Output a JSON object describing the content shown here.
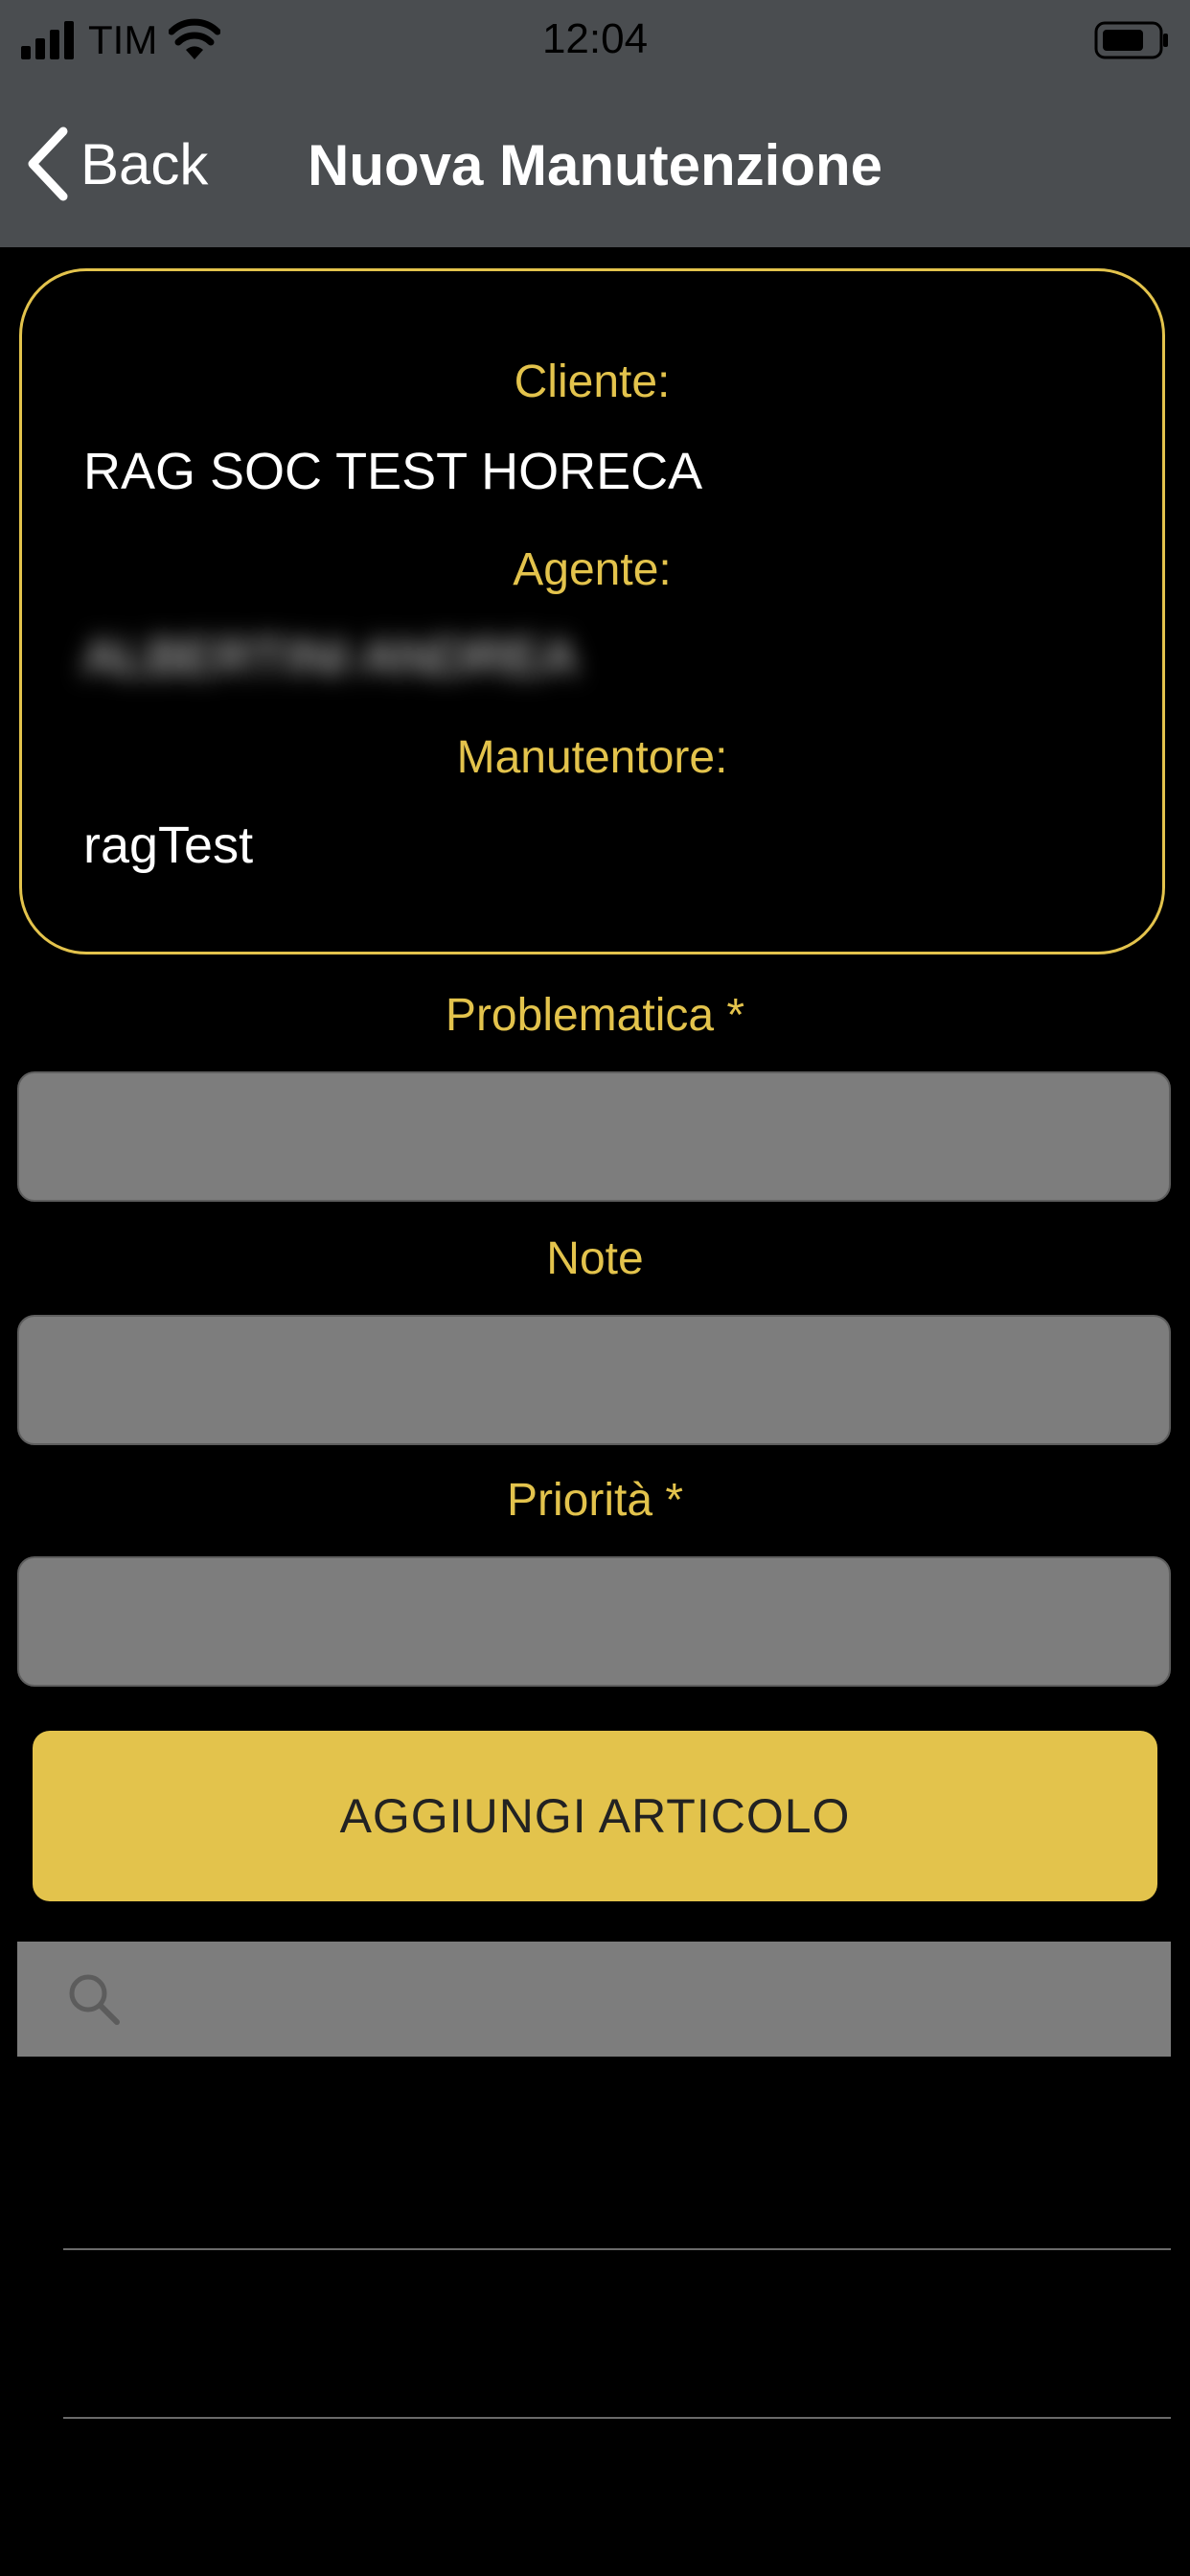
{
  "status_bar": {
    "carrier": "TIM",
    "time": "12:04"
  },
  "nav": {
    "back_label": "Back",
    "title": "Nuova Manutenzione"
  },
  "info": {
    "cliente_label": "Cliente:",
    "cliente_value": "RAG SOC TEST HORECA",
    "agente_label": "Agente:",
    "agente_value": "ALBERTINI ANDREA",
    "manutentore_label": "Manutentore:",
    "manutentore_value": "ragTest"
  },
  "form": {
    "problematica_label": "Problematica *",
    "problematica_value": "",
    "note_label": "Note",
    "note_value": "",
    "priorita_label": "Priorità *",
    "priorita_value": ""
  },
  "add_button_label": "AGGIUNGI ARTICOLO",
  "search": {
    "placeholder": ""
  },
  "colors": {
    "accent": "#e3c34c",
    "bar_background": "#4a4d50",
    "input_background": "#7d7d7d",
    "background": "#000000"
  },
  "icons": [
    "signal-icon",
    "wifi-icon",
    "battery-icon",
    "chevron-left-icon",
    "search-icon"
  ]
}
